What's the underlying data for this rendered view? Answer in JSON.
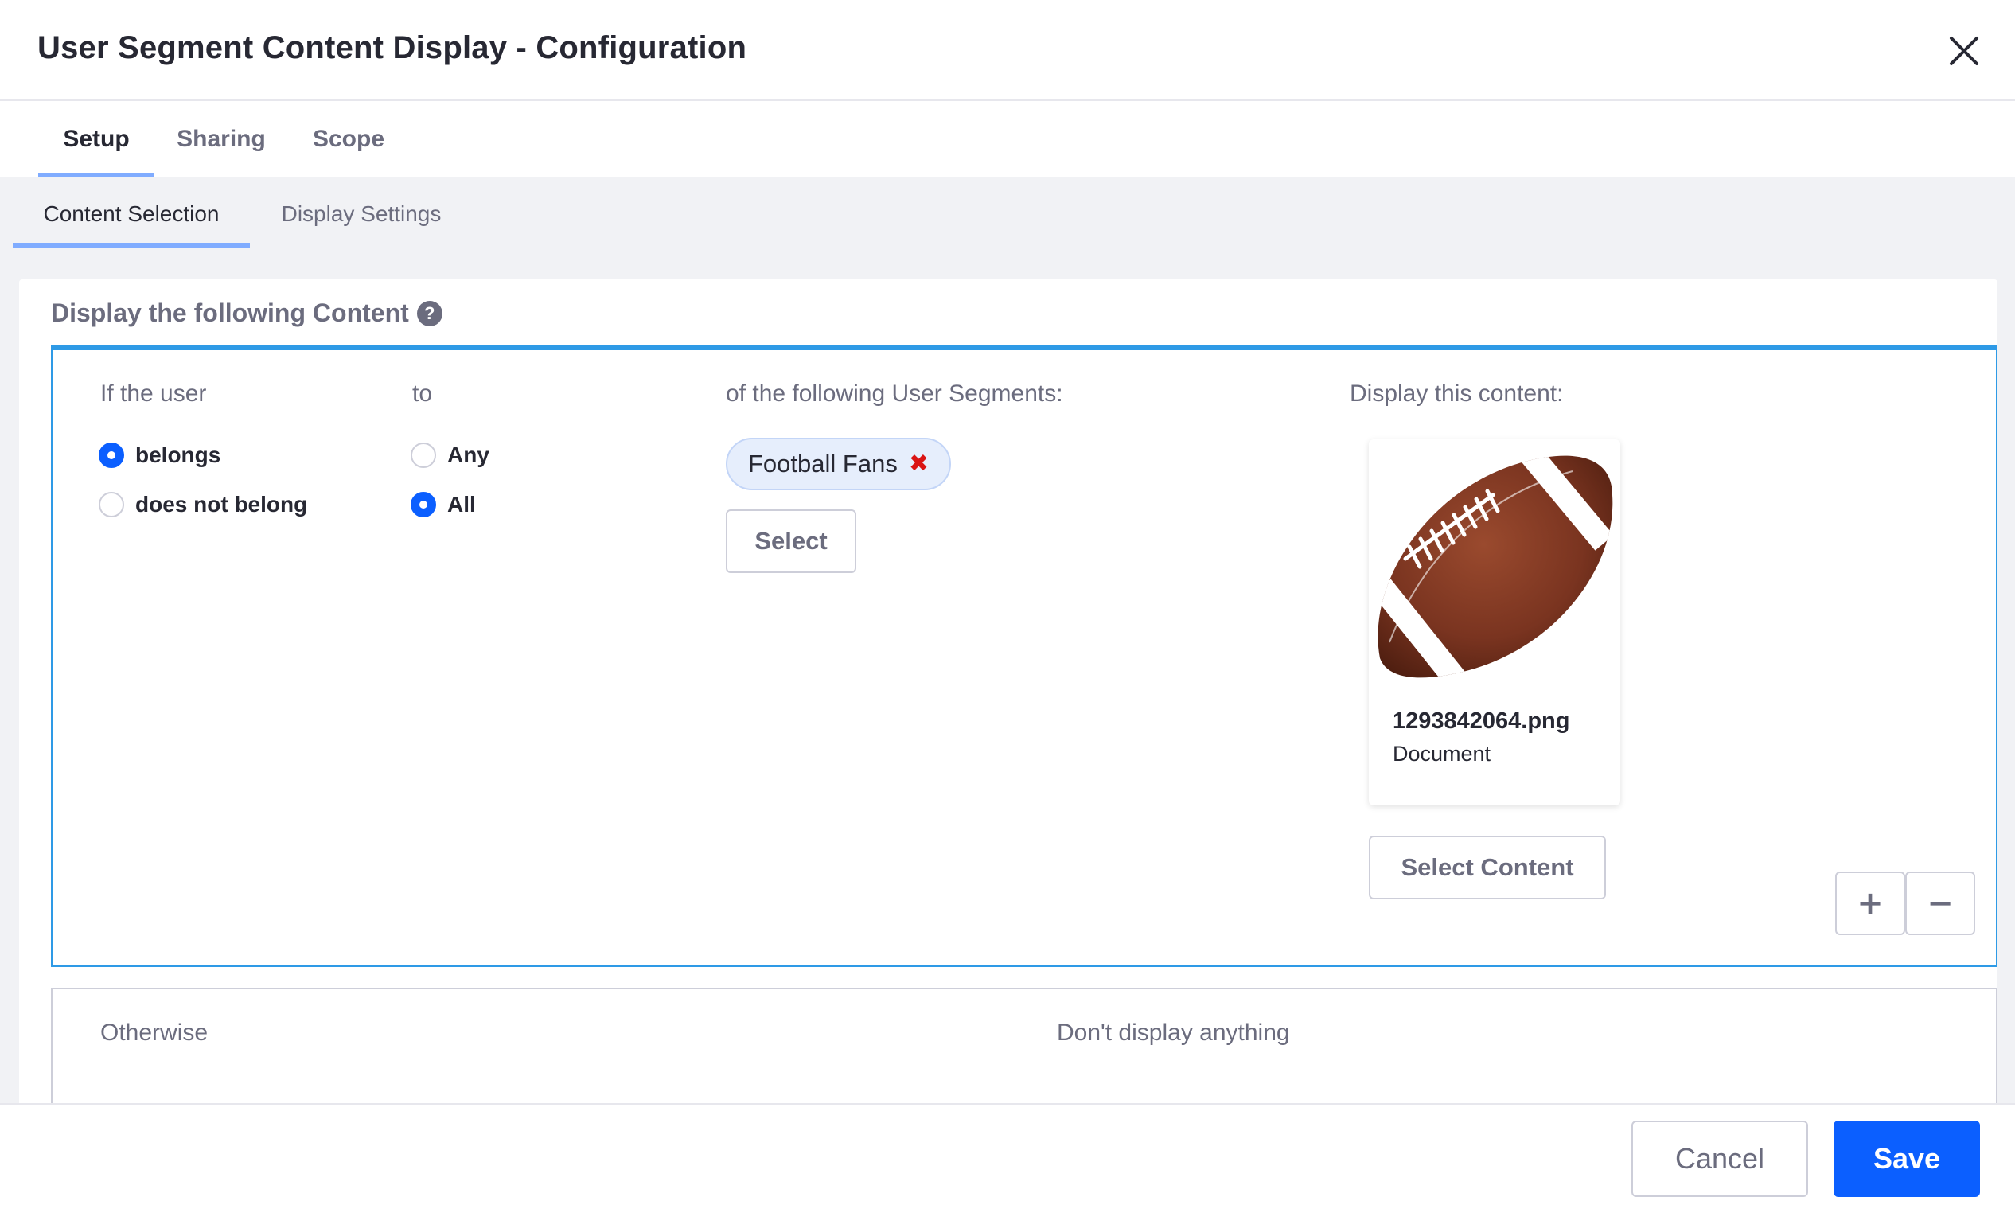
{
  "modal": {
    "title": "User Segment Content Display - Configuration"
  },
  "tabs": [
    {
      "label": "Setup",
      "active": true
    },
    {
      "label": "Sharing",
      "active": false
    },
    {
      "label": "Scope",
      "active": false
    }
  ],
  "subtabs": [
    {
      "label": "Content Selection",
      "active": true
    },
    {
      "label": "Display Settings",
      "active": false
    }
  ],
  "section": {
    "heading": "Display the following Content",
    "help_icon": "question-circle-icon"
  },
  "rule": {
    "user_label": "If the user",
    "membership_options": [
      {
        "label": "belongs",
        "checked": true
      },
      {
        "label": "does not belong",
        "checked": false
      }
    ],
    "to_label": "to",
    "match_options": [
      {
        "label": "Any",
        "checked": false
      },
      {
        "label": "All",
        "checked": true
      }
    ],
    "segments_label": "of the following User Segments:",
    "segments": [
      {
        "name": "Football Fans",
        "remove_icon": "times-icon"
      }
    ],
    "select_label": "Select",
    "content_label": "Display this content:",
    "content": {
      "file_name": "1293842064.png",
      "type": "Document",
      "image_icon": "football-icon"
    },
    "select_content_label": "Select Content",
    "add_icon": "plus-icon",
    "remove_icon": "minus-icon"
  },
  "otherwise": {
    "label": "Otherwise",
    "value": "Don't display anything"
  },
  "footer": {
    "cancel_label": "Cancel",
    "save_label": "Save"
  },
  "colors": {
    "primary": "#0b5fff",
    "tab_indicator": "#80acff",
    "rule_border": "#2e9ae6",
    "chip_bg": "#e6eefc",
    "remove": "#da1414",
    "body_bg": "#f1f2f5"
  }
}
